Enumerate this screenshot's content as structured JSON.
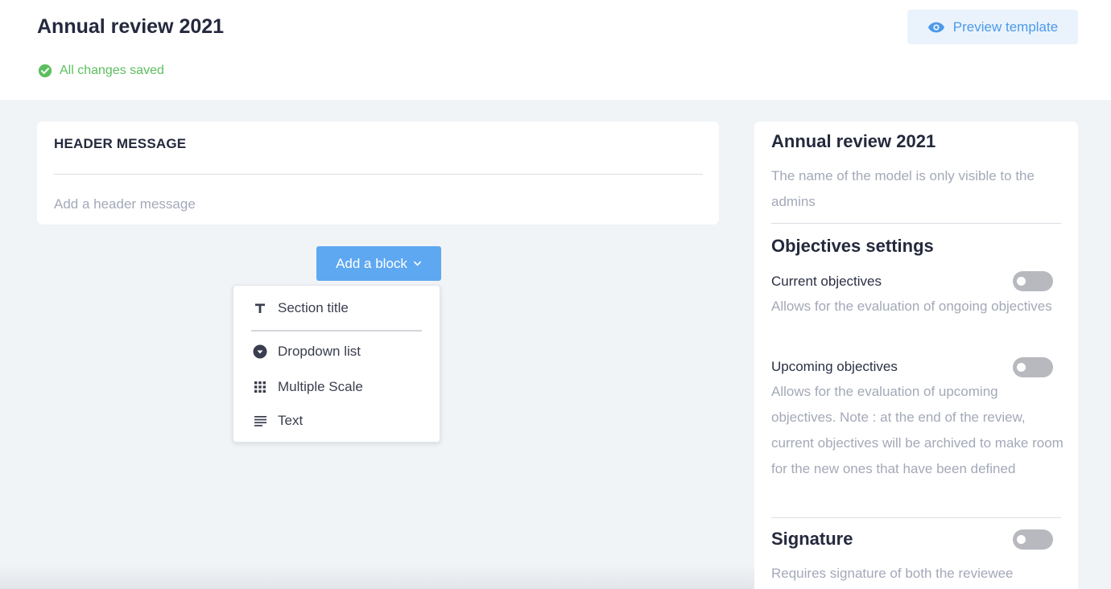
{
  "header": {
    "title": "Annual review 2021",
    "preview_label": "Preview template",
    "saved_status": "All changes saved"
  },
  "header_message": {
    "label": "HEADER MESSAGE",
    "placeholder": "Add a header message"
  },
  "add_block": {
    "label": "Add a block",
    "menu": [
      {
        "label": "Section title",
        "icon": "section-title-icon"
      },
      {
        "label": "Dropdown list",
        "icon": "dropdown-icon"
      },
      {
        "label": "Multiple Scale",
        "icon": "grid-icon"
      },
      {
        "label": "Text",
        "icon": "text-lines-icon"
      }
    ]
  },
  "settings": {
    "model_name": "Annual review 2021",
    "model_note": "The name of the model is only visible to the admins",
    "objectives_heading": "Objectives settings",
    "current_objectives": {
      "label": "Current objectives",
      "description": "Allows for the evaluation of ongoing objectives",
      "enabled": false
    },
    "upcoming_objectives": {
      "label": "Upcoming objectives",
      "description": "Allows for the evaluation of upcoming objectives. Note : at the end of the review, current objectives will be archived to make room for the new ones that have been defined",
      "enabled": false
    },
    "signature": {
      "label": "Signature",
      "description": "Requires signature of both the reviewee",
      "enabled": false
    }
  },
  "colors": {
    "accent": "#5ea8f2",
    "saved_green": "#5cbf5f",
    "toggle_off": "#b7b9bf"
  }
}
